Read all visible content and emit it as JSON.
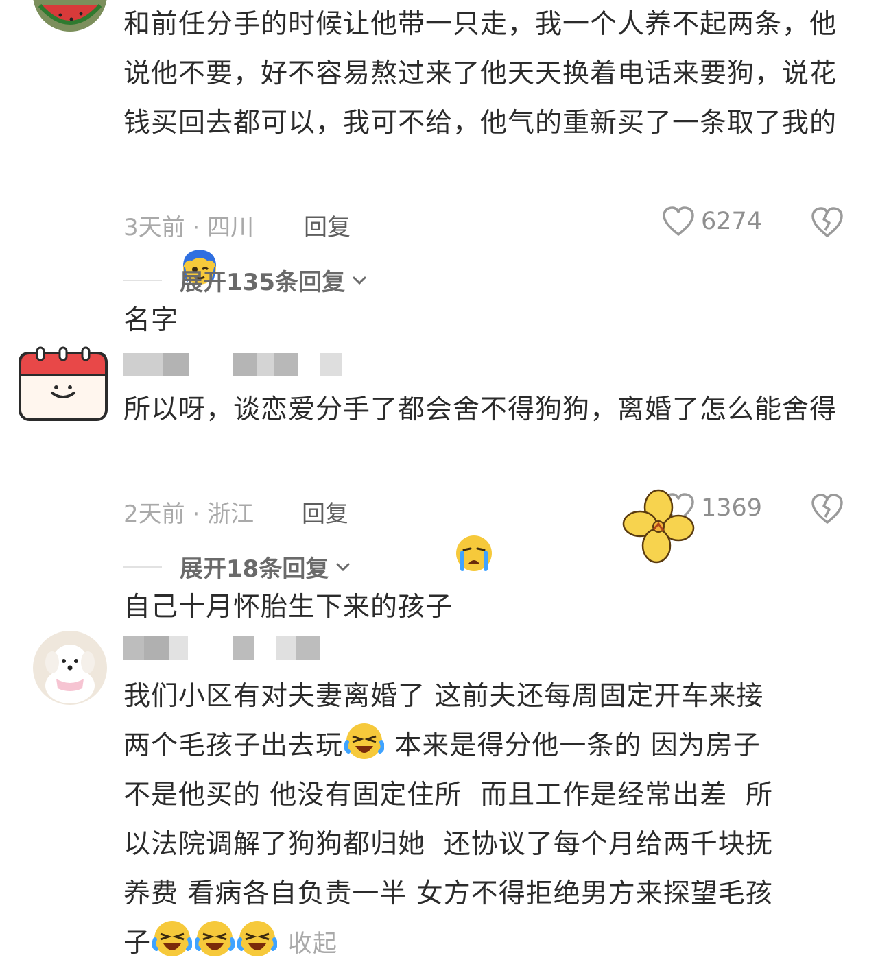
{
  "comments": [
    {
      "text": "和前任分手的时候让他带一只走，我一个人养不起两条，他说他不要，好不容易熬过来了他天天换着电话来要狗，说花钱买回去都可以，我可不给，他气的重新买了一条取了我的名字",
      "emoji_end": "blue-hair-face-emoji",
      "time": "3天前",
      "location": "四川",
      "reply_label": "回复",
      "likes": "6274",
      "expand_label": "展开135条回复"
    },
    {
      "text": "所以呀，谈恋爱分手了都会舍不得狗狗，离婚了怎么能舍得自己十月怀胎生下来的孩子",
      "emoji_end": "crying-face-emoji",
      "time": "2天前",
      "location": "浙江",
      "reply_label": "回复",
      "likes": "1369",
      "expand_label": "展开18条回复"
    },
    {
      "line1": "我们小区有对夫妻离婚了 这前夫还每周固定开车来接",
      "line2a": "两个毛孩子出去玩",
      "line2b": " 本来是得分他一条的 因为房子",
      "line3": "不是他买的 他没有固定住所  而且工作是经常出差  所",
      "line4": "以法院调解了狗狗都归她  还协议了每个月给两千块抚",
      "line5": "养费 看病各自负责一半 女方不得拒绝男方来探望毛孩",
      "line6": "子",
      "collapse_label": "收起"
    }
  ],
  "icons": {
    "like": "heart-outline-icon",
    "dislike": "broken-heart-icon",
    "expand": "chevron-down-icon",
    "sticker": "yellow-flower-sticker"
  }
}
